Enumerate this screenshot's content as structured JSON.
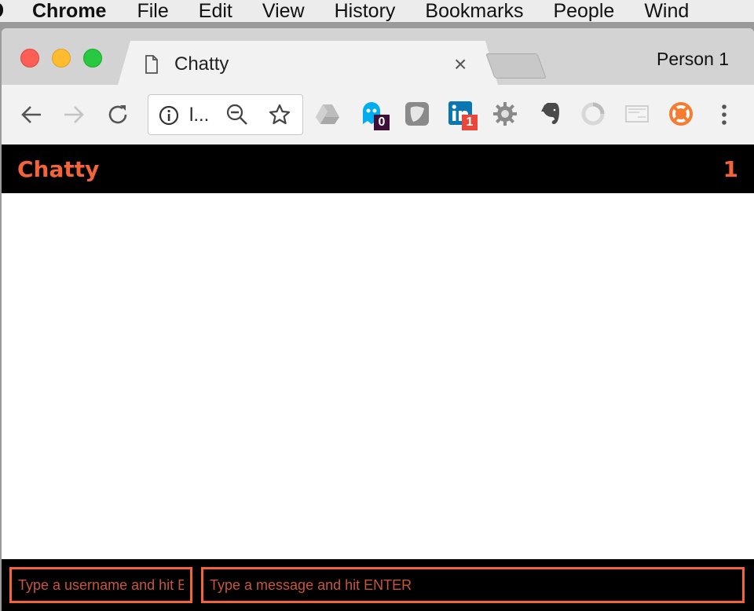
{
  "menubar": {
    "app_name": "Chrome",
    "items": [
      "File",
      "Edit",
      "View",
      "History",
      "Bookmarks",
      "People",
      "Wind"
    ]
  },
  "browser": {
    "tab_title": "Chatty",
    "tab_close": "×",
    "profile_name": "Person 1",
    "omnibox_url": "l...",
    "extensions": [
      {
        "icon": "google-drive-icon"
      },
      {
        "icon": "ghostery-icon",
        "badge": "0",
        "badge_color": "#3b0f3a"
      },
      {
        "icon": "shield-extension-icon"
      },
      {
        "icon": "linkedin-icon",
        "badge": "1",
        "badge_color": "#e8473a"
      },
      {
        "icon": "gear-extension-icon"
      },
      {
        "icon": "evernote-icon"
      },
      {
        "icon": "spinner-extension-icon"
      },
      {
        "icon": "reader-extension-icon"
      },
      {
        "icon": "lifebuoy-extension-icon"
      }
    ]
  },
  "app": {
    "brand": "Chatty",
    "user_count": "1",
    "accent_color": "#f4643a",
    "username_placeholder": "Type a username and hit ENTER",
    "message_placeholder": "Type a message and hit ENTER"
  }
}
